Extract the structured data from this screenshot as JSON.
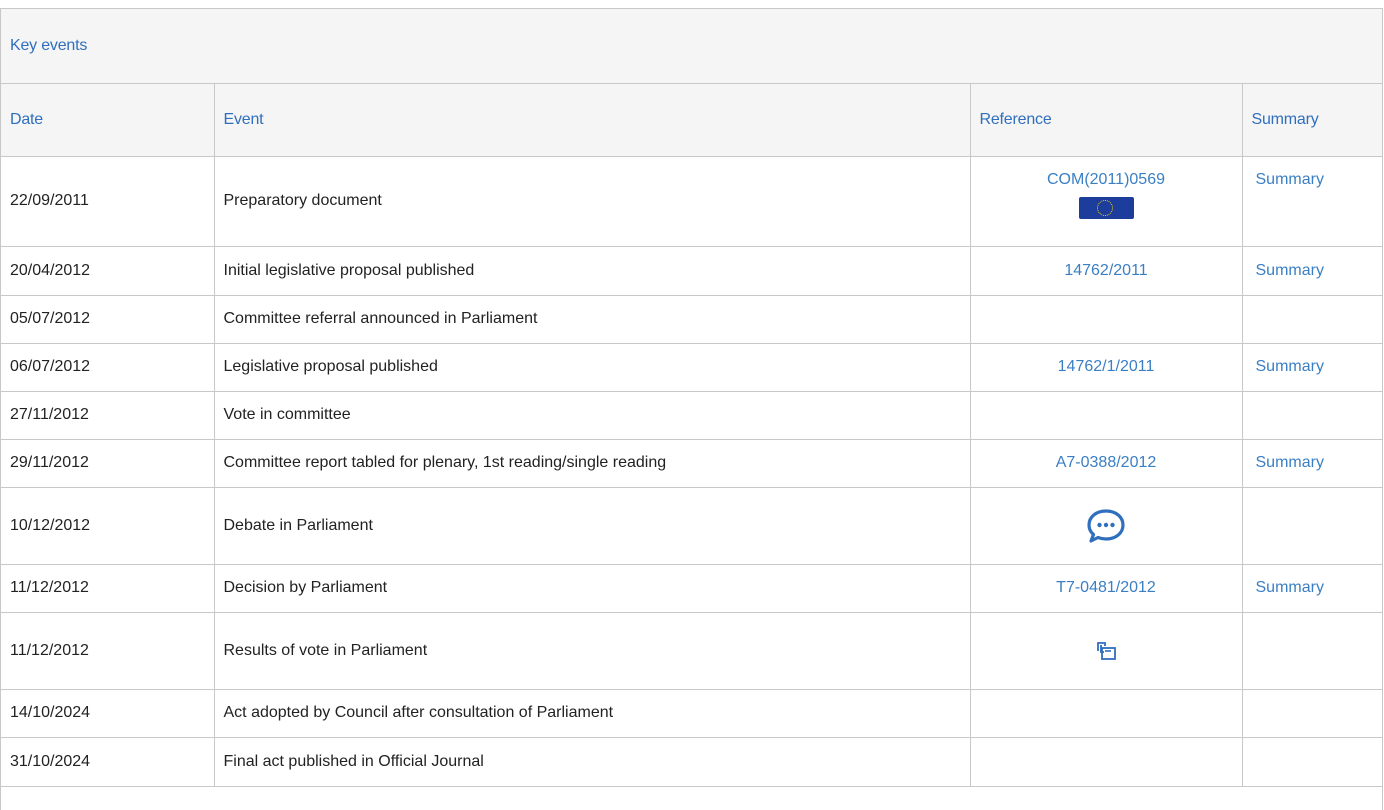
{
  "panel": {
    "title": "Key events"
  },
  "table": {
    "headers": {
      "date": "Date",
      "event": "Event",
      "reference": "Reference",
      "summary": "Summary"
    },
    "rows": [
      {
        "date": "22/09/2011",
        "event": "Preparatory document",
        "reference": "COM(2011)0569",
        "reference_icon": "eu-flag-icon",
        "summary": "Summary"
      },
      {
        "date": "20/04/2012",
        "event": "Initial legislative proposal published",
        "reference": "14762/2011",
        "summary": "Summary"
      },
      {
        "date": "05/07/2012",
        "event": "Committee referral announced in Parliament",
        "reference": "",
        "summary": ""
      },
      {
        "date": "06/07/2012",
        "event": "Legislative proposal published",
        "reference": "14762/1/2011",
        "summary": "Summary"
      },
      {
        "date": "27/11/2012",
        "event": "Vote in committee",
        "reference": "",
        "summary": ""
      },
      {
        "date": "29/11/2012",
        "event": "Committee report tabled for plenary, 1st reading/single reading",
        "reference": "A7-0388/2012",
        "summary": "Summary"
      },
      {
        "date": "10/12/2012",
        "event": "Debate in Parliament",
        "reference": "",
        "reference_icon": "chat-bubble-icon",
        "summary": ""
      },
      {
        "date": "11/12/2012",
        "event": "Decision by Parliament",
        "reference": "T7-0481/2012",
        "summary": "Summary"
      },
      {
        "date": "11/12/2012",
        "event": "Results of vote in Parliament",
        "reference": "",
        "reference_icon": "vote-results-icon",
        "summary": ""
      },
      {
        "date": "14/10/2024",
        "event": "Act adopted by Council after consultation of Parliament",
        "reference": "",
        "summary": ""
      },
      {
        "date": "31/10/2024",
        "event": "Final act published in Official Journal",
        "reference": "",
        "summary": ""
      }
    ]
  },
  "colors": {
    "link": "#3a7fc4",
    "header_text": "#2f6fbd",
    "header_bg": "#f5f5f5",
    "border": "#c8c8c8",
    "eu_flag": "#1c3d9c"
  }
}
